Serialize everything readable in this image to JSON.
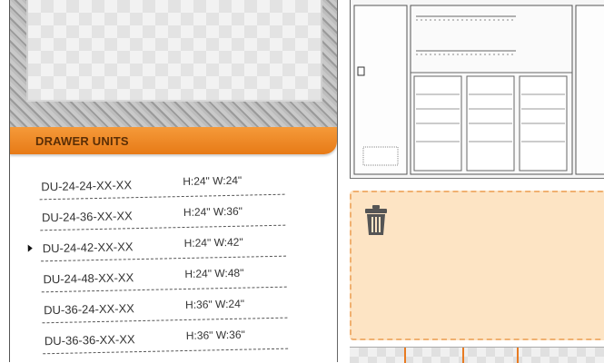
{
  "category": {
    "title": "DRAWER UNITS"
  },
  "items": [
    {
      "code": "DU-24-24-XX-XX",
      "dims": "H:24\" W:24\"",
      "selected": false
    },
    {
      "code": "DU-24-36-XX-XX",
      "dims": "H:24\" W:36\"",
      "selected": false
    },
    {
      "code": "DU-24-42-XX-XX",
      "dims": "H:24\" W:42\"",
      "selected": true
    },
    {
      "code": "DU-24-48-XX-XX",
      "dims": "H:24\" W:48\"",
      "selected": false
    },
    {
      "code": "DU-36-24-XX-XX",
      "dims": "H:36\" W:24\"",
      "selected": false
    },
    {
      "code": "DU-36-36-XX-XX",
      "dims": "H:36\" W:36\"",
      "selected": false
    }
  ],
  "colors": {
    "accent": "#e87b22",
    "drop_zone": "#fde4c4",
    "drop_zone_border": "#f0b070"
  },
  "icons": {
    "trash": "trash-icon",
    "pointer": "selection-pointer-icon"
  }
}
